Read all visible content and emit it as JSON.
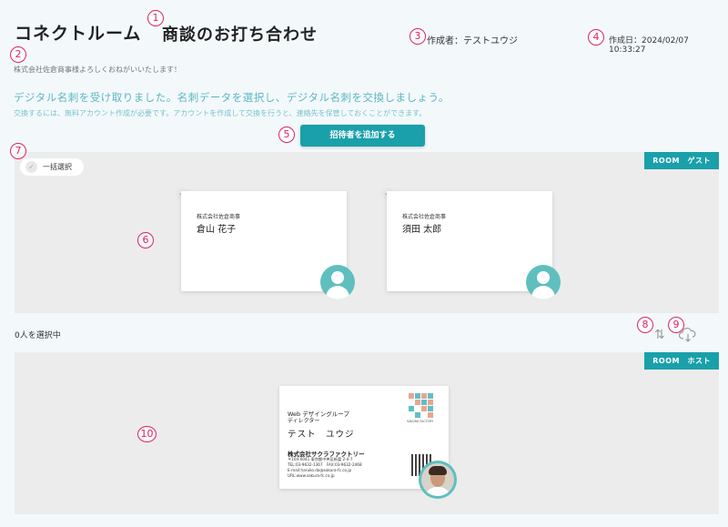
{
  "header": {
    "room_title": "コネクトルーム",
    "meeting_title": "商談のお打ち合わせ",
    "author": "作成者：テストユウジ",
    "created": "作成日：2024/02/07 10:33:27"
  },
  "greeting": "株式会社佐倉商事様よろしくおねがいいたします！",
  "info": {
    "main": "デジタル名刺を受け取りました。名刺データを選択し、デジタル名刺を交換しましょう。",
    "sub": "交換するには、無料アカウント作成が必要です。アカウントを作成して交換を行うと、連絡先を保管しておくことができます。"
  },
  "add_invitee_label": "招待者を追加する",
  "guest_room": {
    "badge": "ROOM　ゲスト",
    "select_all": "一括選択",
    "cards": [
      {
        "company": "株式会社佐倉商事",
        "name": "倉山 花子"
      },
      {
        "company": "株式会社佐倉商事",
        "name": "須田 太郎"
      }
    ]
  },
  "selected_count": "0人を選択中",
  "host_room": {
    "badge": "ROOM　ホスト",
    "card": {
      "dept": "Web デザイングループ",
      "title": "ディレクター",
      "name": "テスト　ユウジ",
      "company": "株式会社サクラファクトリー",
      "logo_text": "SAKURA FACTORY",
      "address_lines": [
        "〒104-0041 東京都中央区新富 2-4-7",
        "TEL:03-9632-1367　FAX:03-9632-2468",
        "E-mail:haruko.da@sakura-fc.co.jp",
        "URL:www.sakura-fc.co.jp"
      ]
    }
  },
  "markers": [
    "1",
    "2",
    "3",
    "4",
    "5",
    "6",
    "7",
    "8",
    "9",
    "10"
  ],
  "icons": {
    "swap": "swap-icon",
    "download": "cloud-download-icon",
    "check": "check-icon",
    "avatar": "user-avatar-icon"
  },
  "colors": {
    "accent": "#1aa0aa",
    "info": "#5cb6c4",
    "marker": "#e0245e"
  }
}
